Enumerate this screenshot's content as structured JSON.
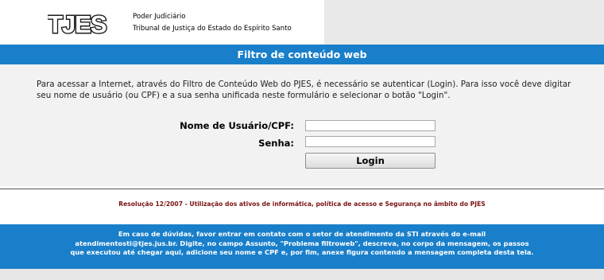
{
  "header": {
    "logo_text": "TJES",
    "org_line1": "Poder Judiciário",
    "org_line2": "Tribunal de Justiça do Estado do Espírito Santo"
  },
  "banner": {
    "title": "Filtro de conteúdo web"
  },
  "intro": {
    "text": "Para acessar a Internet, através do Filtro de Conteúdo Web do PJES, é necessário se autenticar (Login). Para isso você deve digitar seu nome de usuário (ou CPF) e a sua senha unificada neste formulário e selecionar o botão \"Login\"."
  },
  "form": {
    "username_label": "Nome de Usuário/CPF:",
    "username_value": "",
    "password_label": "Senha:",
    "password_value": "",
    "login_label": "Login"
  },
  "resolution": {
    "text": "Resolução 12/2007 - Utilização dos ativos de informática, política de acesso e Segurança no âmbito do PJES"
  },
  "footer": {
    "line1": "Em caso de dúvidas, favor entrar em contato com o setor de atendimento da STI através do e-mail",
    "line2": "atendimentosti@tjes.jus.br. Digite, no campo Assunto, \"Problema filtroweb\", descreva, no corpo da mensagem, os passos",
    "line3": "que executou até chegar aqui, adicione seu nome e CPF e, por fim, anexe figura contendo a mensagem completa desta tela."
  },
  "colors": {
    "banner_blue": "#1a7fca",
    "resolution_red": "#7a1111",
    "panel_gray": "#f2f2f2"
  }
}
